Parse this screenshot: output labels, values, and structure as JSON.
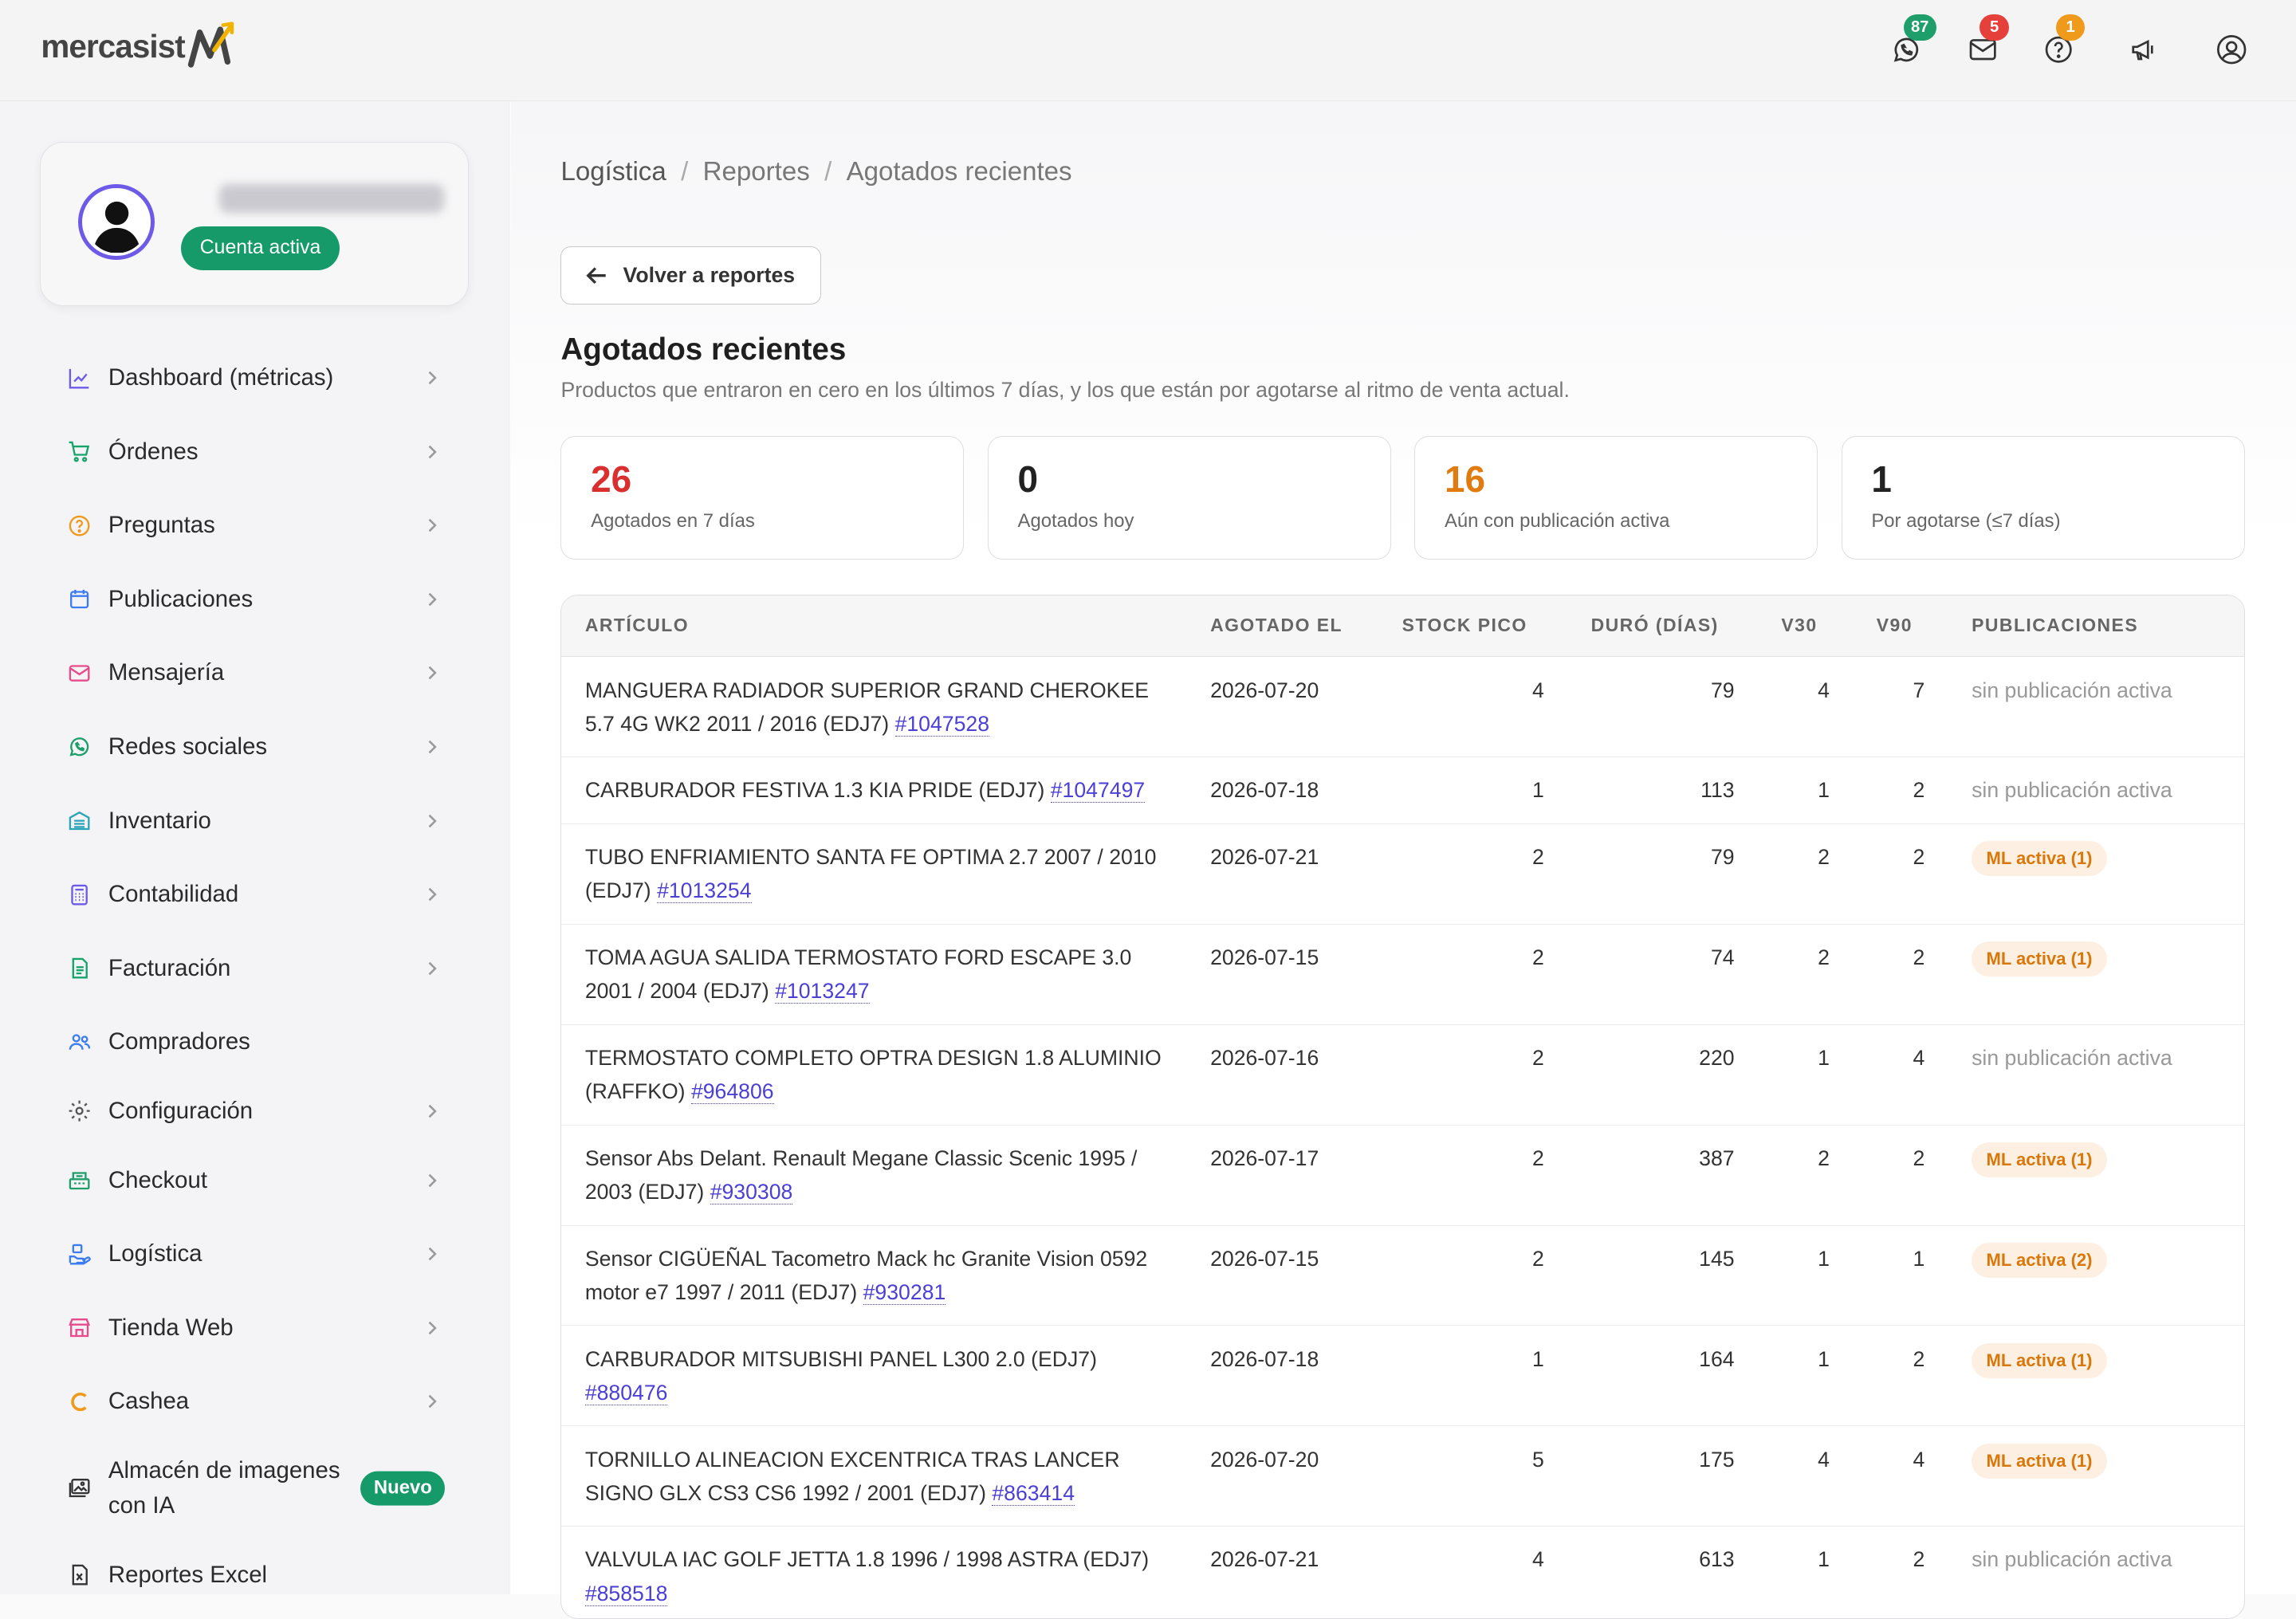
{
  "brand": {
    "name": "mercasist"
  },
  "topbar": {
    "badges": {
      "whatsapp": "87",
      "mail": "5",
      "help": "1"
    },
    "badge_colors": {
      "whatsapp": "#1e9e6a",
      "mail": "#e5403a",
      "help": "#f09a1b"
    }
  },
  "profile": {
    "status": "Cuenta activa"
  },
  "sidebar": {
    "items": [
      {
        "label": "Dashboard (métricas)",
        "icon": "chart-line-icon",
        "color": "#6d5be8"
      },
      {
        "label": "Órdenes",
        "icon": "cart-icon",
        "color": "#16a36a"
      },
      {
        "label": "Preguntas",
        "icon": "question-circle-icon",
        "color": "#f09a1b"
      },
      {
        "label": "Publicaciones",
        "icon": "calendar-icon",
        "color": "#3b7cf0"
      },
      {
        "label": "Mensajería",
        "icon": "mail-icon",
        "color": "#e84a8a"
      },
      {
        "label": "Redes sociales",
        "icon": "whatsapp-icon",
        "color": "#1e9e6a"
      },
      {
        "label": "Inventario",
        "icon": "warehouse-icon",
        "color": "#2aa4b8"
      },
      {
        "label": "Contabilidad",
        "icon": "calculator-icon",
        "color": "#6d5be8"
      },
      {
        "label": "Facturación",
        "icon": "invoice-icon",
        "color": "#16a36a"
      },
      {
        "label": "Compradores",
        "icon": "users-icon",
        "color": "#3b7cf0"
      },
      {
        "label": "Configuración",
        "icon": "gear-icon",
        "color": "#555"
      },
      {
        "label": "Checkout",
        "icon": "register-icon",
        "color": "#1e9e6a"
      },
      {
        "label": "Logística",
        "icon": "delivery-icon",
        "color": "#3b7cf0"
      },
      {
        "label": "Tienda Web",
        "icon": "store-icon",
        "color": "#e84a8a"
      },
      {
        "label": "Cashea",
        "icon": "cashea-icon",
        "color": "#f09a1b"
      },
      {
        "label": "Almacén de imagenes con IA",
        "icon": "image-gallery-icon",
        "color": "#333",
        "badge": "Nuevo"
      },
      {
        "label": "Reportes Excel",
        "icon": "excel-file-icon",
        "color": "#333"
      }
    ]
  },
  "breadcrumb": [
    "Logística",
    "Reportes",
    "Agotados recientes"
  ],
  "back_button": "Volver a reportes",
  "page": {
    "title": "Agotados recientes",
    "subtitle": "Productos que entraron en cero en los últimos 7 días, y los que están por agotarse al ritmo de venta actual."
  },
  "stats": [
    {
      "value": "26",
      "label": "Agotados en 7 días",
      "color": "#d92f2f"
    },
    {
      "value": "0",
      "label": "Agotados hoy",
      "color": "#222222"
    },
    {
      "value": "16",
      "label": "Aún con publicación activa",
      "color": "#e07b0f"
    },
    {
      "value": "1",
      "label": "Por agotarse (≤7 días)",
      "color": "#222222"
    }
  ],
  "table": {
    "columns": [
      "ARTÍCULO",
      "AGOTADO EL",
      "STOCK PICO",
      "DURÓ (DÍAS)",
      "V30",
      "V90",
      "PUBLICACIONES"
    ],
    "rows": [
      {
        "name": "MANGUERA RADIADOR SUPERIOR GRAND CHEROKEE 5.7 4G WK2 2011 / 2016 (EDJ7)",
        "sku": "#1047528",
        "date": "2026-07-20",
        "peak": "4",
        "days": "79",
        "v30": "4",
        "v90": "7",
        "pub": "sin publicación activa",
        "pub_active": false
      },
      {
        "name": "CARBURADOR FESTIVA 1.3 KIA PRIDE (EDJ7)",
        "sku": "#1047497",
        "date": "2026-07-18",
        "peak": "1",
        "days": "113",
        "v30": "1",
        "v90": "2",
        "pub": "sin publicación activa",
        "pub_active": false
      },
      {
        "name": "TUBO ENFRIAMIENTO SANTA FE OPTIMA 2.7 2007 / 2010 (EDJ7)",
        "sku": "#1013254",
        "date": "2026-07-21",
        "peak": "2",
        "days": "79",
        "v30": "2",
        "v90": "2",
        "pub": "ML activa (1)",
        "pub_active": true
      },
      {
        "name": "TOMA AGUA SALIDA TERMOSTATO FORD ESCAPE 3.0 2001 / 2004 (EDJ7)",
        "sku": "#1013247",
        "date": "2026-07-15",
        "peak": "2",
        "days": "74",
        "v30": "2",
        "v90": "2",
        "pub": "ML activa (1)",
        "pub_active": true
      },
      {
        "name": "TERMOSTATO COMPLETO OPTRA DESIGN 1.8 ALUMINIO (RAFFKO)",
        "sku": "#964806",
        "date": "2026-07-16",
        "peak": "2",
        "days": "220",
        "v30": "1",
        "v90": "4",
        "pub": "sin publicación activa",
        "pub_active": false
      },
      {
        "name": "Sensor Abs Delant. Renault Megane Classic Scenic 1995 / 2003 (EDJ7)",
        "sku": "#930308",
        "date": "2026-07-17",
        "peak": "2",
        "days": "387",
        "v30": "2",
        "v90": "2",
        "pub": "ML activa (1)",
        "pub_active": true
      },
      {
        "name": "Sensor CIGÜEÑAL Tacometro Mack hc Granite Vision 0592 motor e7 1997 / 2011 (EDJ7)",
        "sku": "#930281",
        "date": "2026-07-15",
        "peak": "2",
        "days": "145",
        "v30": "1",
        "v90": "1",
        "pub": "ML activa (2)",
        "pub_active": true
      },
      {
        "name": "CARBURADOR MITSUBISHI PANEL L300 2.0 (EDJ7)",
        "sku": "#880476",
        "date": "2026-07-18",
        "peak": "1",
        "days": "164",
        "v30": "1",
        "v90": "2",
        "pub": "ML activa (1)",
        "pub_active": true
      },
      {
        "name": "TORNILLO ALINEACION EXCENTRICA TRAS LANCER SIGNO GLX CS3 CS6 1992 / 2001 (EDJ7)",
        "sku": "#863414",
        "date": "2026-07-20",
        "peak": "5",
        "days": "175",
        "v30": "4",
        "v90": "4",
        "pub": "ML activa (1)",
        "pub_active": true
      },
      {
        "name": "VALVULA IAC GOLF JETTA 1.8 1996 / 1998 ASTRA (EDJ7)",
        "sku": "#858518",
        "date": "2026-07-21",
        "peak": "4",
        "days": "613",
        "v30": "1",
        "v90": "2",
        "pub": "sin publicación activa",
        "pub_active": false
      }
    ]
  }
}
